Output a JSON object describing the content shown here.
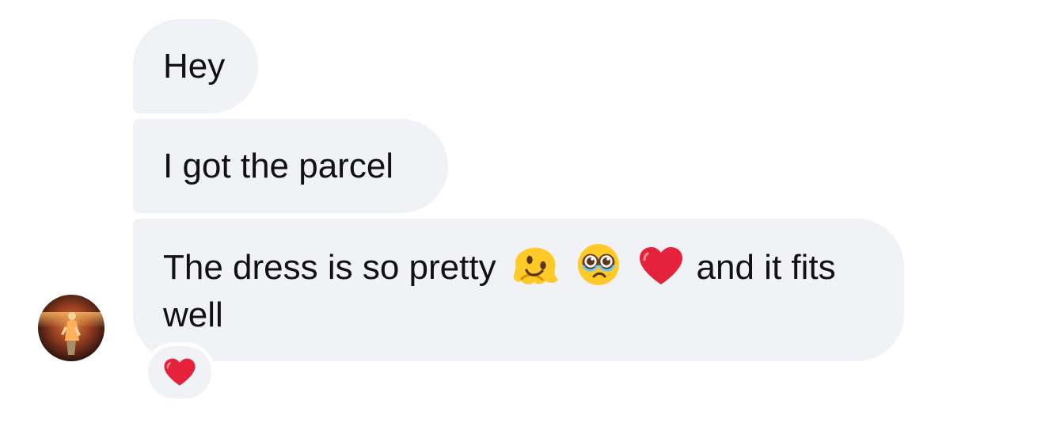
{
  "conversation": {
    "messages": [
      {
        "text": "Hey"
      },
      {
        "text": "I got the parcel"
      },
      {
        "text_before": "The dress is so pretty",
        "emoji_sequence": [
          "melting-face",
          "pleading-face",
          "red-heart"
        ],
        "text_after": "and it fits well"
      }
    ],
    "reaction": {
      "emoji": "red-heart"
    }
  },
  "colors": {
    "bubble_background": "#f0f2f5",
    "text": "#111111",
    "reaction_heart": "#e5223b"
  }
}
